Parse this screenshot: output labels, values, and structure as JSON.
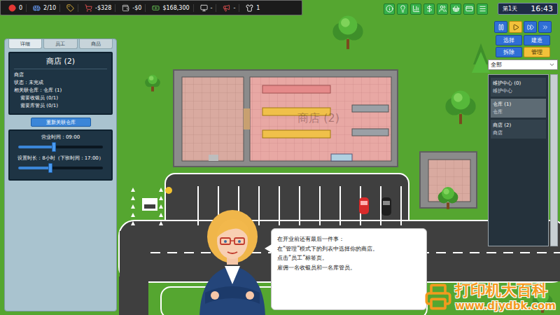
{
  "top_bar": {
    "stats": [
      {
        "kind": "alert",
        "value": "0"
      },
      {
        "kind": "bus",
        "value": "2/10"
      },
      {
        "kind": "tag"
      },
      {
        "kind": "cart",
        "value": "-$328"
      },
      {
        "kind": "wallet",
        "value": "-$0"
      },
      {
        "kind": "cash",
        "value": "$168,300"
      },
      {
        "kind": "monitor",
        "value": "-"
      },
      {
        "kind": "megaphone",
        "value": "-"
      },
      {
        "kind": "shirt",
        "value": "1"
      }
    ]
  },
  "clock": {
    "day": "第1天",
    "time": "16:43"
  },
  "speed_controls": [
    {
      "selected": false
    },
    {
      "selected": true
    },
    {
      "selected": false
    },
    {
      "selected": false
    }
  ],
  "modes": [
    {
      "label": "选择",
      "selected": false
    },
    {
      "label": "建造",
      "selected": false
    },
    {
      "label": "拆除",
      "selected": false
    },
    {
      "label": "管理",
      "selected": true
    }
  ],
  "filter": {
    "value": "全部"
  },
  "building_list": {
    "items": [
      {
        "title": "维护中心 (0)",
        "subtitle": "维护中心",
        "selected": false
      },
      {
        "title": "仓库 (1)",
        "subtitle": "仓库",
        "selected": true
      },
      {
        "title": "商店 (2)",
        "subtitle": "商店",
        "selected": false
      }
    ]
  },
  "details_panel": {
    "tabs": [
      {
        "label": "详细",
        "selected": true
      },
      {
        "label": "员工",
        "selected": false
      },
      {
        "label": "商品",
        "selected": false
      }
    ],
    "title": "商店 (2)",
    "lines": [
      {
        "text": "商店",
        "indent": false
      },
      {
        "text": "状态：未完成",
        "indent": false
      },
      {
        "text": "相关联仓库：仓库 (1)",
        "indent": false
      },
      {
        "text": "需要收银员 (0/1)",
        "indent": true
      },
      {
        "text": "需要库管员 (0/1)",
        "indent": true
      }
    ],
    "button": "重新关联仓库",
    "settings": [
      {
        "label": "营业时间：09:00",
        "level": 0.42
      },
      {
        "label": "设置时长：8小时（下班时间：17:00）",
        "level": 0.38
      }
    ]
  },
  "map": {
    "building_label": "商店 (2)"
  },
  "tutorial": {
    "lines": [
      "在开业前还有最后一件事：",
      "在“管理”模式下的列表中选择你的商店。",
      "点击“员工”标签页。",
      "雇佣一名收银员和一名库管员。"
    ]
  },
  "watermark": {
    "title": "打印机大百科",
    "url": "www.djydbk.com"
  }
}
